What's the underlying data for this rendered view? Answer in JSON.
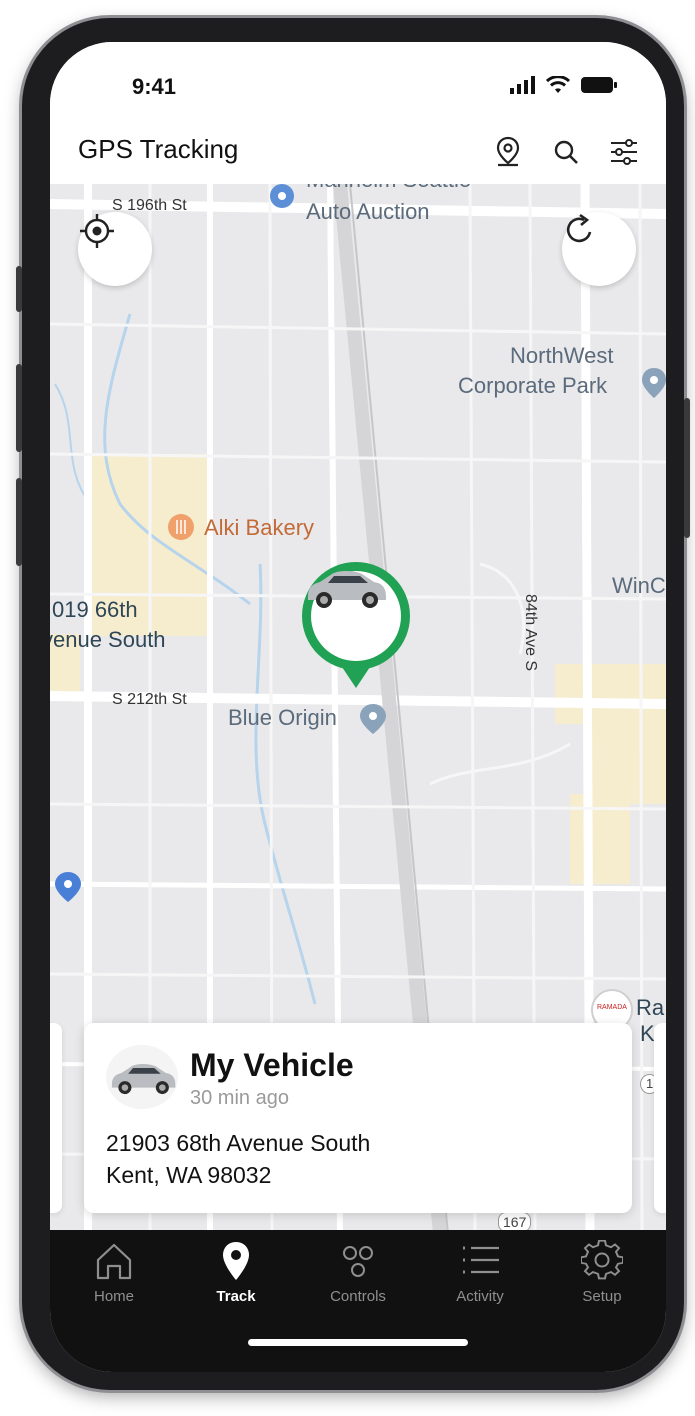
{
  "status_bar": {
    "time": "9:41"
  },
  "header": {
    "title": "GPS Tracking"
  },
  "map": {
    "labels": {
      "auction_top": "Manheim Seattle",
      "auction": "Auto Auction",
      "s196": "S 196th St",
      "northwest_1": "NorthWest",
      "northwest_2": "Corporate Park",
      "alki": "Alki Bakery",
      "win": "WinC",
      "addr_66th_1": "019 66th",
      "addr_66th_2": "venue South",
      "s212": "S 212th St",
      "blue_origin": "Blue Origin",
      "ave84": "84th Ave S",
      "ramada_badge": "RAMADA",
      "ra": "Ra",
      "k": "K",
      "road_167": "167",
      "road_1": "1"
    }
  },
  "vehicle_card": {
    "name": "My Vehicle",
    "updated": "30 min ago",
    "address_line1": "21903 68th Avenue South",
    "address_line2": "Kent, WA 98032"
  },
  "nav": {
    "items": [
      {
        "label": "Home",
        "icon": "home-icon"
      },
      {
        "label": "Track",
        "icon": "location-pin-icon",
        "active": true
      },
      {
        "label": "Controls",
        "icon": "controls-icon"
      },
      {
        "label": "Activity",
        "icon": "list-icon"
      },
      {
        "label": "Setup",
        "icon": "gear-icon"
      }
    ]
  },
  "colors": {
    "accent": "#21a153",
    "nav_bg": "#111111",
    "map_bg": "#e9e9eb"
  }
}
